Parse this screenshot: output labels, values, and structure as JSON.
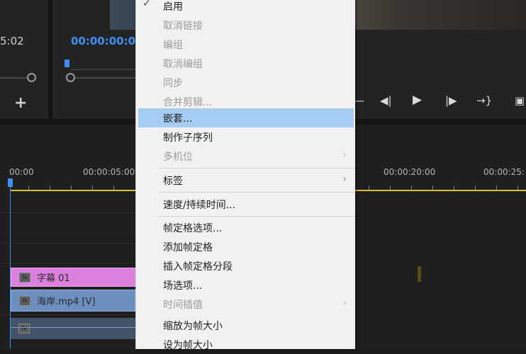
{
  "monitor": {
    "source_timecode": "5:02",
    "program_timecode": "00:00:00:0"
  },
  "timeline": {
    "ruler": [
      "00:00",
      "00:00:05:00",
      "00:00:20:00",
      "00:00:25:"
    ],
    "clips": {
      "title": "字幕 01",
      "video": "海岸.mp4 [V]"
    }
  },
  "icons": {
    "add": "plus-icon",
    "controls": [
      "trim-icon",
      "step-back-icon",
      "play-icon",
      "step-forward-icon",
      "go-to-out-icon",
      "export-frame-icon"
    ]
  },
  "menu": {
    "items": [
      {
        "label": "启用",
        "enabled": true,
        "checked": true
      },
      {
        "label": "取消链接",
        "enabled": false
      },
      {
        "label": "编组",
        "enabled": false
      },
      {
        "label": "取消编组",
        "enabled": false
      },
      {
        "label": "同步",
        "enabled": false
      },
      {
        "label": "合并剪辑...",
        "enabled": false
      },
      {
        "label": "嵌套...",
        "enabled": true,
        "highlighted": true
      },
      {
        "label": "制作子序列",
        "enabled": true
      },
      {
        "label": "多机位",
        "enabled": false,
        "submenu": true
      },
      {
        "label": "标签",
        "enabled": true,
        "submenu": true
      },
      {
        "label": "速度/持续时间...",
        "enabled": true
      },
      {
        "label": "帧定格选项...",
        "enabled": true
      },
      {
        "label": "添加帧定格",
        "enabled": true
      },
      {
        "label": "插入帧定格分段",
        "enabled": true
      },
      {
        "label": "场选项...",
        "enabled": true
      },
      {
        "label": "时间插值",
        "enabled": false,
        "submenu": true
      },
      {
        "label": "缩放为帧大小",
        "enabled": true
      },
      {
        "label": "设为帧大小",
        "enabled": true
      }
    ]
  },
  "colors": {
    "accent_blue": "#3a8ef2",
    "menu_highlight": "#a5cdf1",
    "title_clip": "#dd7fdd",
    "video_clip": "#6d8fc0",
    "work_area": "#d7c33a"
  }
}
